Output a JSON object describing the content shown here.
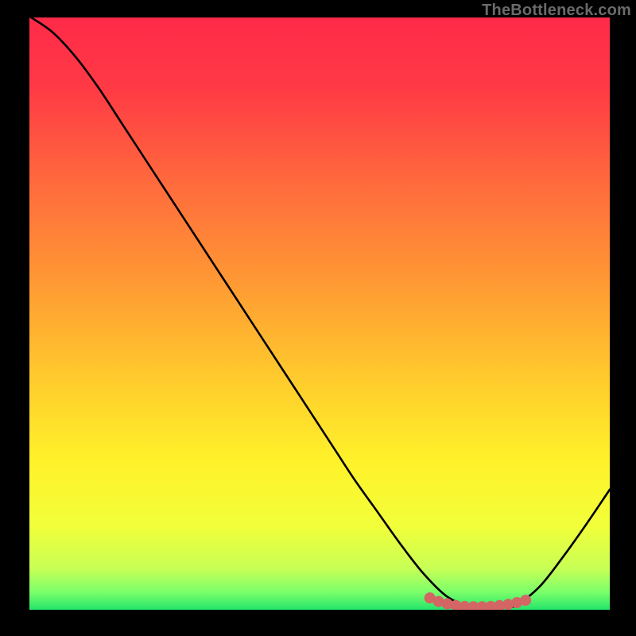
{
  "watermark": "TheBottleneck.com",
  "chart_data": {
    "type": "line",
    "title": "",
    "xlabel": "",
    "ylabel": "",
    "xlim": [
      0,
      100
    ],
    "ylim": [
      0,
      100
    ],
    "grid": false,
    "series": [
      {
        "name": "curve",
        "x": [
          0,
          4,
          8,
          12,
          16,
          20,
          24,
          28,
          32,
          36,
          40,
          44,
          48,
          52,
          56,
          60,
          64,
          68,
          72,
          76,
          80,
          82,
          84,
          88,
          92,
          96,
          100
        ],
        "y": [
          100.2,
          97.5,
          93.3,
          88.0,
          82.0,
          76.0,
          70.0,
          64.0,
          58.0,
          52.0,
          46.0,
          40.0,
          34.0,
          28.0,
          22.0,
          16.5,
          11.0,
          6.0,
          2.2,
          0.5,
          0.3,
          0.4,
          0.8,
          4.0,
          9.0,
          14.5,
          20.3
        ],
        "color": "#000000"
      }
    ],
    "valley_markers": {
      "name": "valley-dots",
      "x": [
        69,
        70.5,
        72,
        73.5,
        75,
        76.5,
        78,
        79.5,
        81,
        82.5,
        84,
        85.5
      ],
      "y": [
        2.0,
        1.4,
        1.0,
        0.7,
        0.55,
        0.5,
        0.5,
        0.55,
        0.7,
        0.9,
        1.2,
        1.6
      ],
      "color": "#d46565",
      "radius": 7
    },
    "gradient_stops": [
      {
        "offset": 0,
        "color": "#ff2a49"
      },
      {
        "offset": 12,
        "color": "#ff3a45"
      },
      {
        "offset": 28,
        "color": "#ff6a3d"
      },
      {
        "offset": 45,
        "color": "#ff9a33"
      },
      {
        "offset": 60,
        "color": "#ffc82d"
      },
      {
        "offset": 75,
        "color": "#fff22a"
      },
      {
        "offset": 86,
        "color": "#f1ff3a"
      },
      {
        "offset": 93,
        "color": "#c8ff55"
      },
      {
        "offset": 97,
        "color": "#7bff6a"
      },
      {
        "offset": 100,
        "color": "#24e56b"
      }
    ]
  }
}
